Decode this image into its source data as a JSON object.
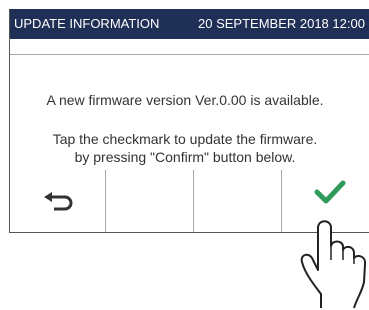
{
  "header": {
    "title": "UPDATE INFORMATION",
    "datetime": "20 SEPTEMBER 2018 12:00"
  },
  "message": {
    "line1": "A new firmware version Ver.0.00 is available.",
    "line2": "Tap the checkmark to update the firmware.",
    "line3": "by pressing \"Confirm\" button below."
  },
  "buttons": {
    "back_icon": "back-arrow-icon",
    "confirm_icon": "checkmark-icon"
  },
  "colors": {
    "header_bg": "#1f2f56",
    "header_text": "#ffffff",
    "check_green": "#2f9a5a"
  }
}
